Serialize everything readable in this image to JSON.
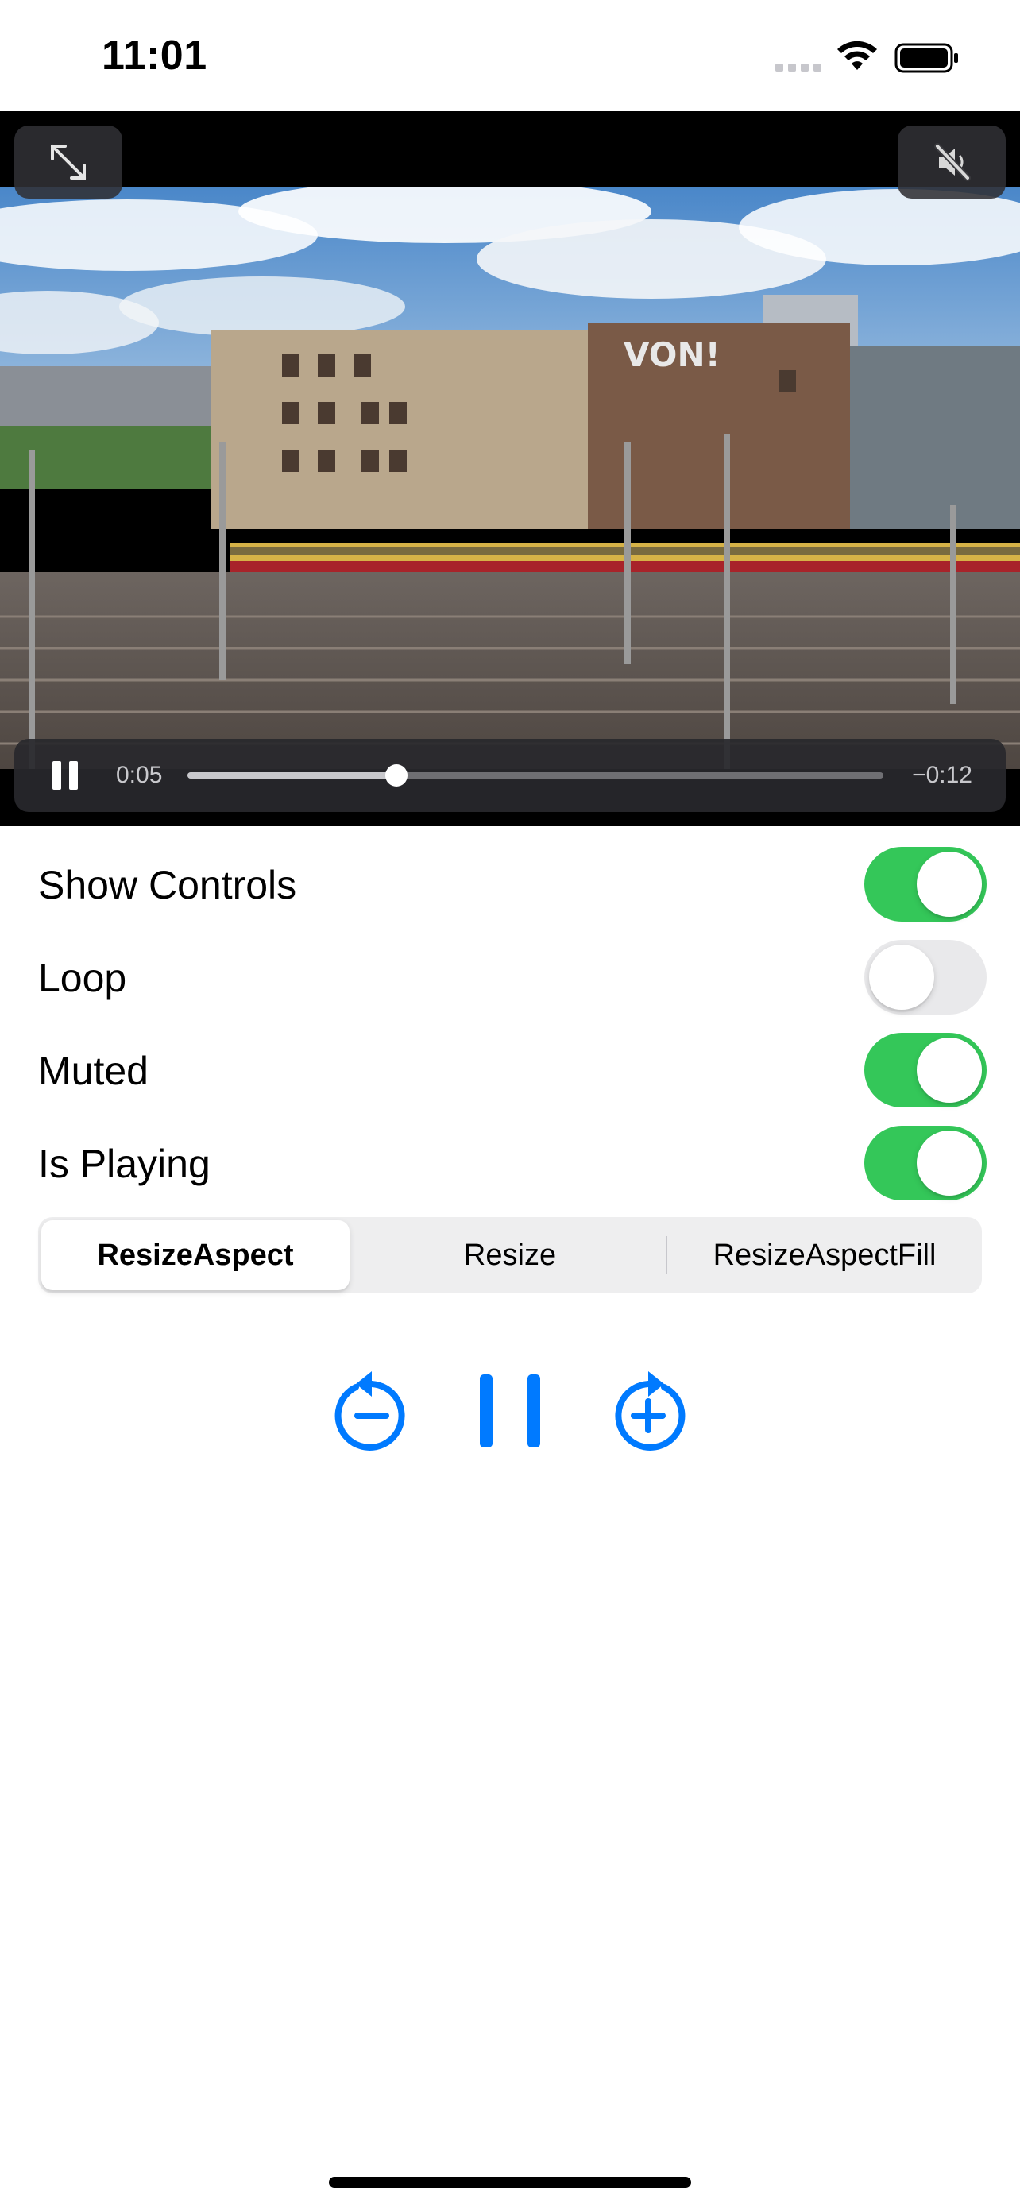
{
  "status_bar": {
    "time": "11:01",
    "icons": [
      "cellular-signal-icon",
      "wifi-icon",
      "battery-icon"
    ]
  },
  "video": {
    "overlay_buttons": [
      "fullscreen-icon",
      "speaker-muted-icon"
    ],
    "playback_state": "playing",
    "elapsed": "0:05",
    "remaining": "−0:12",
    "progress_fraction": 0.3
  },
  "settings": {
    "toggles": [
      {
        "label": "Show Controls",
        "on": true
      },
      {
        "label": "Loop",
        "on": false
      },
      {
        "label": "Muted",
        "on": true
      },
      {
        "label": "Is Playing",
        "on": true
      }
    ],
    "segments": [
      {
        "label": "ResizeAspect",
        "selected": true
      },
      {
        "label": "Resize",
        "selected": false
      },
      {
        "label": "ResizeAspectFill",
        "selected": false
      }
    ]
  },
  "transport": {
    "buttons": [
      "rewind-icon",
      "pause-icon",
      "forward-icon"
    ]
  },
  "colors": {
    "accent": "#007aff",
    "toggle_on": "#34c759",
    "toggle_off": "#e9e9eb"
  }
}
